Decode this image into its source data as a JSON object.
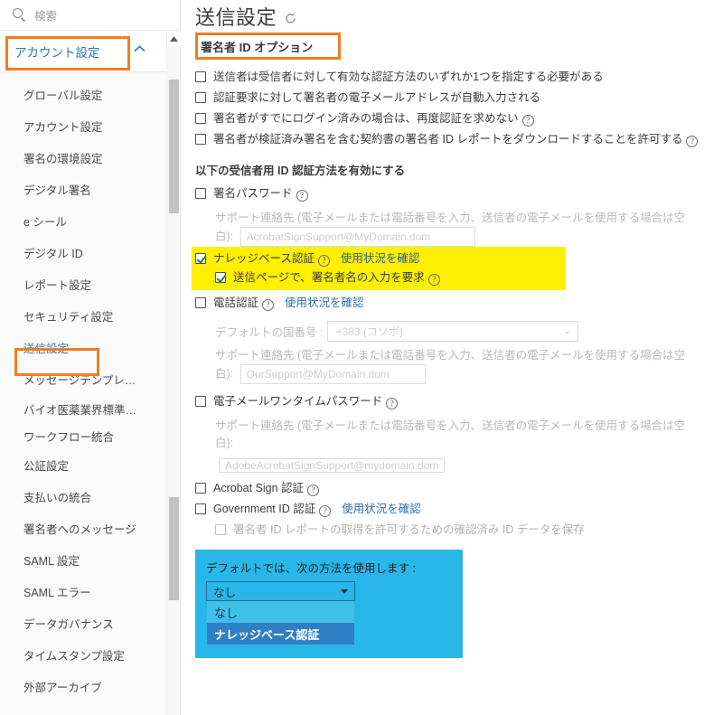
{
  "sidebar": {
    "search": {
      "placeholder": "検索",
      "icon": "search-icon"
    },
    "account_header": {
      "label": "アカウント設定",
      "chevron": "chevron-up-icon"
    },
    "items": [
      {
        "label": "グローバル設定"
      },
      {
        "label": "アカウント設定"
      },
      {
        "label": "署名の環境設定"
      },
      {
        "label": "デジタル署名"
      },
      {
        "label": "e シール"
      },
      {
        "label": "デジタル ID"
      },
      {
        "label": "レポート設定"
      },
      {
        "label": "セキュリティ設定"
      },
      {
        "label": "送信設定"
      },
      {
        "label": "メッセージテンプレ…"
      },
      {
        "label": "バイオ医薬業界標準…"
      },
      {
        "label": "ワークフロー統合"
      },
      {
        "label": "公証設定"
      },
      {
        "label": "支払いの統合"
      },
      {
        "label": "署名者へのメッセージ"
      },
      {
        "label": "SAML 設定"
      },
      {
        "label": "SAML エラー"
      },
      {
        "label": "データガバナンス"
      },
      {
        "label": "タイムスタンプ設定"
      },
      {
        "label": "外部アーカイブ"
      }
    ]
  },
  "main": {
    "page_title": "送信設定",
    "refresh_icon": "refresh-icon",
    "section_title": "署名者 ID オプション",
    "top_options": [
      {
        "label": "送信者は受信者に対して有効な認証方法のいずれか1つを指定する必要がある",
        "checked": false,
        "help": false
      },
      {
        "label": "認証要求に対して署名者の電子メールアドレスが自動入力される",
        "checked": false,
        "help": false
      },
      {
        "label": "署名者がすでにログイン済みの場合は、再度認証を求めない",
        "checked": false,
        "help": true
      },
      {
        "label": "署名者が検証済み署名を含む契約書の署名者 ID レポートをダウンロードすることを許可する",
        "checked": false,
        "help": true
      }
    ],
    "methods_heading": "以下の受信者用 ID 認証方法を有効にする",
    "signing_password": {
      "label": "署名パスワード",
      "checked": false,
      "support_note": "サポート連絡先 (電子メールまたは電話番号を入力、送信者の電子メールを使用する場合は空白):",
      "input_value": "AcrobatSignSupport@MyDomain.dom"
    },
    "kba": {
      "label": "ナレッジベース認証",
      "checked": true,
      "usage_link": "使用状況を確認",
      "sub_label": "送信ページで、署名者名の入力を要求",
      "sub_checked": true
    },
    "phone": {
      "label": "電話認証",
      "checked": false,
      "usage_link": "使用状況を確認",
      "country_label": "デフォルトの国番号 :",
      "country_value": "+383 (コソボ)",
      "support_note": "サポート連絡先 (電子メールまたは電話番号を入力、送信者の電子メールを使用する場合は空白):",
      "input_value": "OurSupport@MyDomain.dom"
    },
    "email_otp": {
      "label": "電子メールワンタイムパスワード",
      "checked": false,
      "support_note": "サポート連絡先 (電子メールまたは電話番号を入力、送信者の電子メールを使用する場合は空白):",
      "input_value": "AdobeAcrobatSignSupport@mydomain.dom"
    },
    "acrobat_sign_auth": {
      "label": "Acrobat Sign 認証",
      "checked": false
    },
    "government_id": {
      "label": "Government ID 認証",
      "checked": false,
      "usage_link": "使用状況を確認",
      "sub_label": "署名者 ID レポートの取得を許可するための確認済み ID データを保存",
      "sub_checked": false
    },
    "default_method": {
      "label": "デフォルトでは、次の方法を使用します :",
      "selected": "なし",
      "options": [
        {
          "label": "なし",
          "active": false
        },
        {
          "label": "ナレッジベース認証",
          "active": true
        }
      ]
    }
  },
  "colors": {
    "highlight_orange": "#f07d22",
    "highlight_yellow": "#ffef00",
    "highlight_blue": "#29b6e8",
    "link_blue": "#2a6fad",
    "option_selected": "#2f7fc4"
  }
}
